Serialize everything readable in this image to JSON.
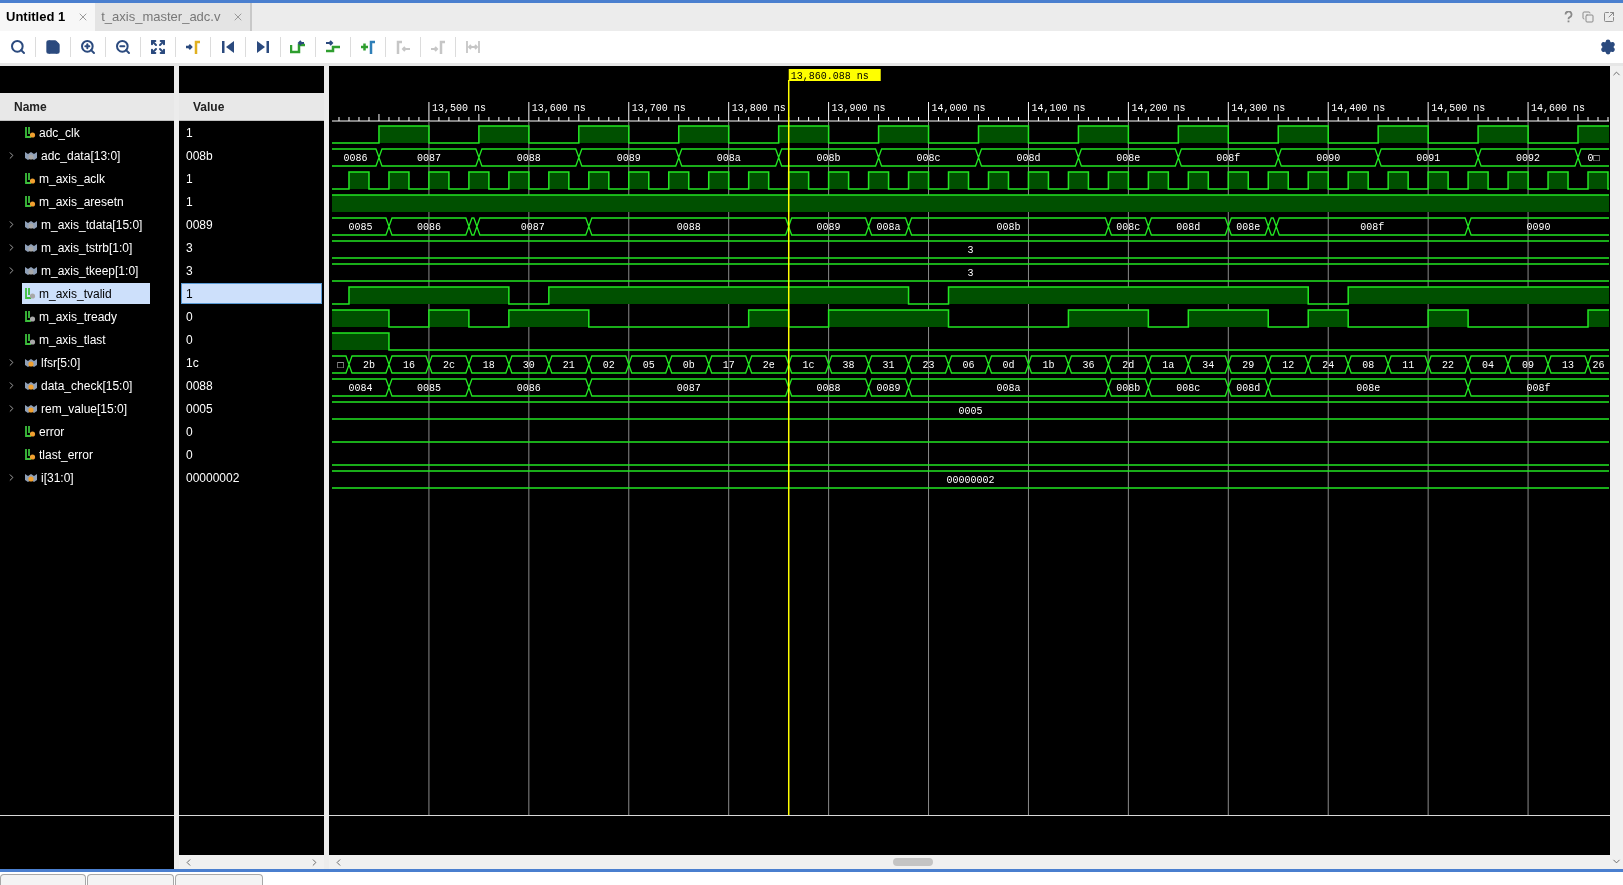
{
  "tabs": [
    {
      "label": "Untitled 1",
      "selected": true
    },
    {
      "label": "t_axis_master_adc.v",
      "selected": false
    }
  ],
  "toolbar": [
    {
      "disabled": false
    },
    {
      "disabled": false
    },
    {
      "disabled": false
    },
    {
      "disabled": false
    },
    {
      "disabled": false
    },
    {
      "disabled": false
    },
    {
      "disabled": false
    },
    {
      "disabled": false
    },
    {
      "disabled": false
    },
    {
      "disabled": false
    },
    {
      "disabled": false
    },
    {
      "disabled": true
    },
    {
      "disabled": true
    },
    {
      "disabled": true
    }
  ],
  "columns": {
    "name": "Name",
    "value": "Value"
  },
  "timeline": {
    "ticks": [
      "13,500 ns",
      "13,600 ns",
      "13,700 ns",
      "13,800 ns",
      "13,900 ns",
      "14,000 ns",
      "14,100 ns",
      "14,200 ns",
      "14,300 ns",
      "14,400 ns",
      "14,500 ns",
      "14,600 ns"
    ],
    "cursor": {
      "label": "13,860.088 ns"
    }
  },
  "signals": [
    {
      "name": "adc_clk",
      "value": "1",
      "selected": false,
      "color": "#f0a030",
      "kind": "bit"
    },
    {
      "name": "adc_data[13:0]",
      "value": "008b",
      "selected": false,
      "color": "#a8a8a8",
      "kind": "bus",
      "segments": [
        "0086",
        "0087",
        "0088",
        "0089",
        "008a",
        "008b",
        "008c",
        "008d",
        "008e",
        "008f",
        "0090",
        "0091",
        "0092",
        "0□"
      ]
    },
    {
      "name": "m_axis_aclk",
      "value": "1",
      "selected": false,
      "color": "#f0a030",
      "kind": "bit"
    },
    {
      "name": "m_axis_aresetn",
      "value": "1",
      "selected": false,
      "color": "#f0a030",
      "kind": "bit"
    },
    {
      "name": "m_axis_tdata[15:0]",
      "value": "0089",
      "selected": false,
      "color": "#a8a8a8",
      "kind": "bus",
      "segments": [
        "0085",
        "0086",
        "0087",
        "0088",
        "0089",
        "008a",
        "008b",
        "008c",
        "008d",
        "008e",
        "008f",
        "0090"
      ]
    },
    {
      "name": "m_axis_tstrb[1:0]",
      "value": "3",
      "selected": false,
      "color": "#a8a8a8",
      "kind": "bus",
      "segments": [
        "3"
      ]
    },
    {
      "name": "m_axis_tkeep[1:0]",
      "value": "3",
      "selected": false,
      "color": "#a8a8a8",
      "kind": "bus",
      "segments": [
        "3"
      ]
    },
    {
      "name": "m_axis_tvalid",
      "value": "1",
      "selected": true,
      "color": "#a8a8a8",
      "kind": "bit"
    },
    {
      "name": "m_axis_tready",
      "value": "0",
      "selected": false,
      "color": "#a8a8a8",
      "kind": "bit"
    },
    {
      "name": "m_axis_tlast",
      "value": "0",
      "selected": false,
      "color": "#a8a8a8",
      "kind": "bit"
    },
    {
      "name": "lfsr[5:0]",
      "value": "1c",
      "selected": false,
      "color": "#f0a030",
      "kind": "bus",
      "segments": [
        "□",
        "2b",
        "16",
        "2c",
        "18",
        "30",
        "21",
        "02",
        "05",
        "0b",
        "17",
        "2e",
        "1c",
        "38",
        "31",
        "23",
        "06",
        "0d",
        "1b",
        "36",
        "2d",
        "1a",
        "34",
        "29",
        "12",
        "24",
        "08",
        "11",
        "22",
        "04",
        "09",
        "13",
        "26"
      ]
    },
    {
      "name": "data_check[15:0]",
      "value": "0088",
      "selected": false,
      "color": "#f0a030",
      "kind": "bus",
      "segments": [
        "0084",
        "0085",
        "0086",
        "0087",
        "0088",
        "0089",
        "008a",
        "008b",
        "008c",
        "008d",
        "008e",
        "008f"
      ]
    },
    {
      "name": "rem_value[15:0]",
      "value": "0005",
      "selected": false,
      "color": "#f0a030",
      "kind": "bus",
      "segments": [
        "0005"
      ]
    },
    {
      "name": "error",
      "value": "0",
      "selected": false,
      "color": "#f0a030",
      "kind": "bit"
    },
    {
      "name": "tlast_error",
      "value": "0",
      "selected": false,
      "color": "#f0a030",
      "kind": "bit"
    },
    {
      "name": "i[31:0]",
      "value": "00000002",
      "selected": false,
      "color": "#f0a030",
      "kind": "bus",
      "segments": [
        "00000002"
      ]
    }
  ]
}
